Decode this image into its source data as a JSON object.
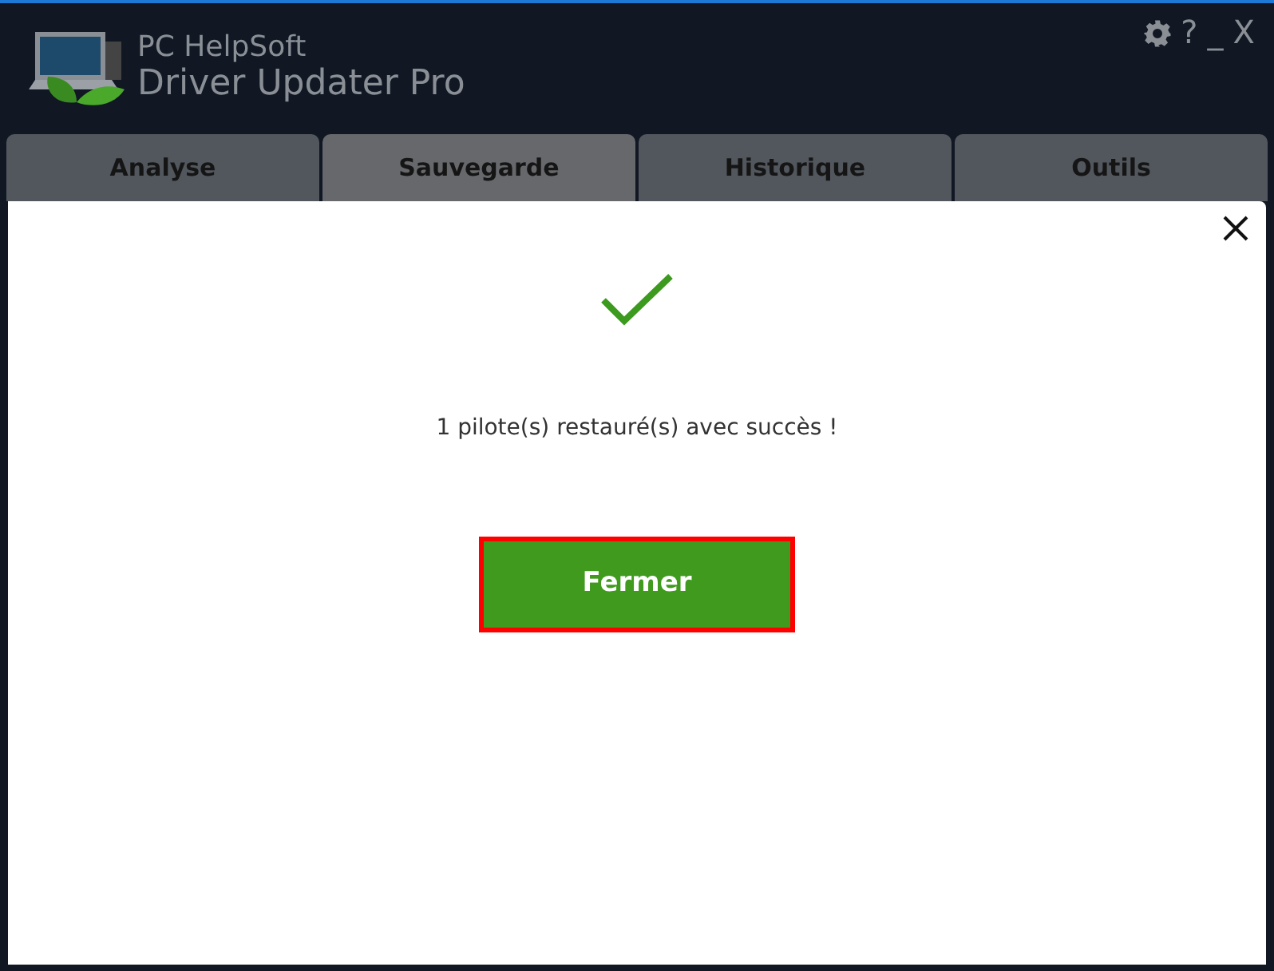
{
  "app": {
    "vendor": "PC HelpSoft",
    "title": "Driver Updater Pro"
  },
  "window_controls": [
    "?",
    "_",
    "X"
  ],
  "tabs": [
    {
      "label": "Analyse",
      "selected": false
    },
    {
      "label": "Sauvegarde",
      "selected": true
    },
    {
      "label": "Historique",
      "selected": false
    },
    {
      "label": "Outils",
      "selected": false
    }
  ],
  "dialog": {
    "message": "1 pilote(s) restauré(s) avec succès !",
    "button": {
      "label": "Fermer",
      "highlighted": true
    }
  }
}
